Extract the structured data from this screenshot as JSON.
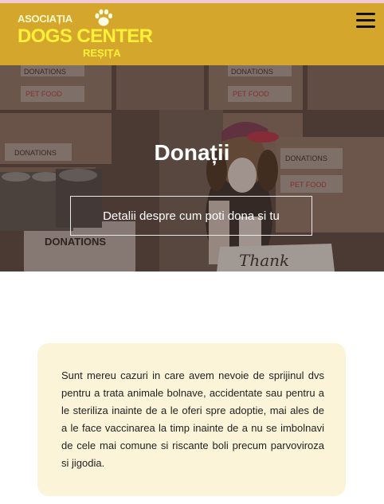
{
  "header": {
    "logo_line1": "ASOCIAȚIA",
    "logo_line2": "DOGS CENTER",
    "logo_line3": "REȘIȚA",
    "logo_icon": "paw-icon",
    "menu_icon": "hamburger-menu-icon",
    "background": "#d4a72c"
  },
  "hero": {
    "title": "Donații",
    "button_label": "Detalii despre cum poti dona si tu",
    "photo_labels": {
      "donations": "DONATIONS",
      "pet_food": "PET FOOD",
      "thank": "Thank"
    }
  },
  "content": {
    "paragraph": "Sunt mereu cazuri in care avem nevoie de sprijinul dvs pentru a trata animale bolnave, accidentate sau pentru a le steriliza inainte de a le oferi spre adoptie, mai ales de a le face vaccinarea la timp inainte de a nu se imbolnavi de cele mai comune si riscante boli precum parvoviroza si jigodia.",
    "card_color": "#fcf4d8"
  }
}
